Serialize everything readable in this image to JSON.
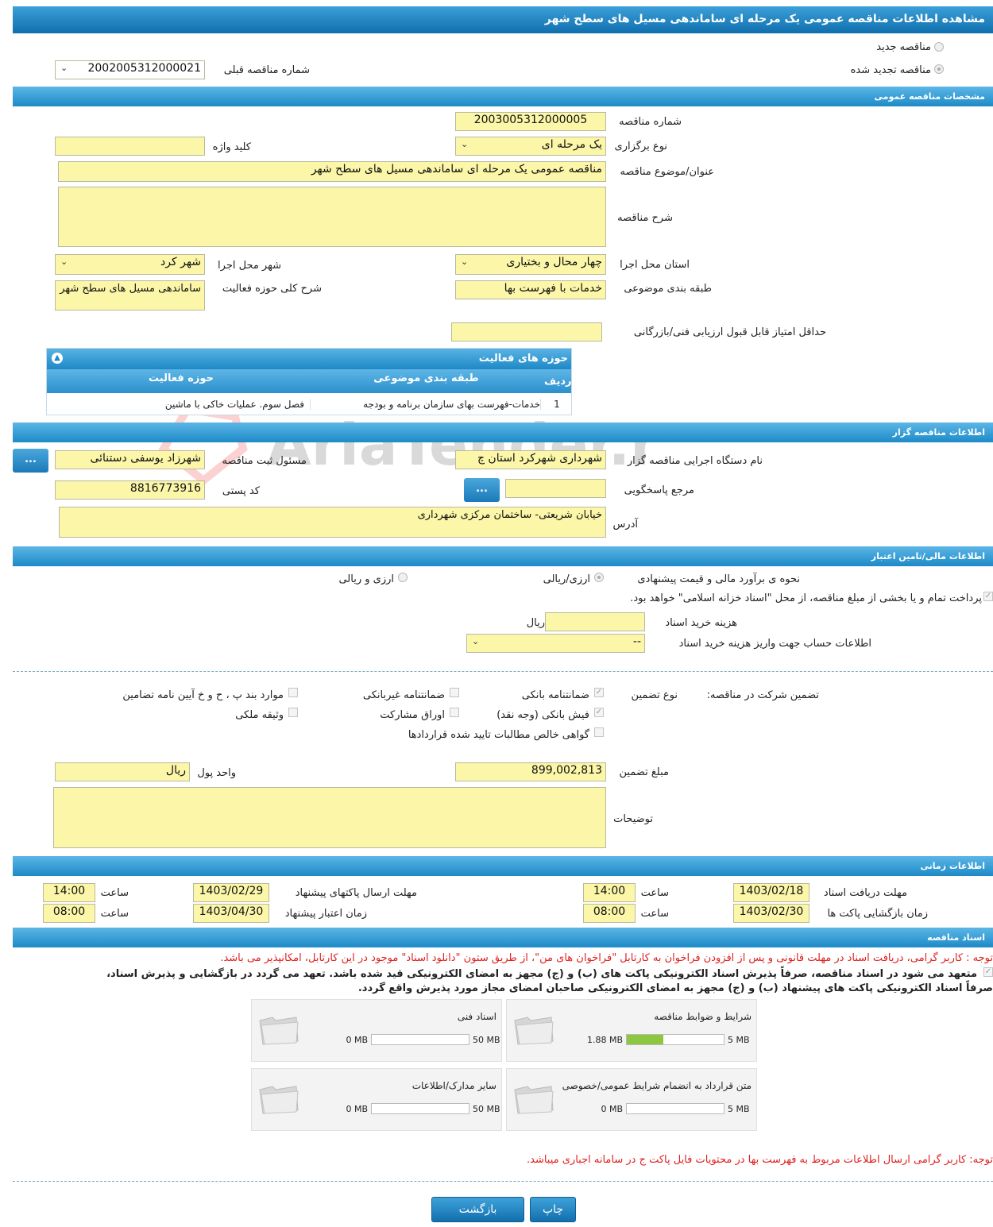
{
  "page": {
    "title": "مشاهده اطلاعات مناقصه عمومی یک مرحله ای ساماندهی مسیل های سطح شهر",
    "radio_new": "مناقصه جدید",
    "radio_renewed": "مناقصه تجدید شده",
    "prev_number_label": "شماره مناقصه قبلی",
    "prev_number_value": "2002005312000021"
  },
  "general": {
    "header": "مشخصات مناقصه عمومی",
    "number_label": "شماره مناقصه",
    "number_value": "2003005312000005",
    "type_label": "نوع برگزاری",
    "type_value": "یک مرحله ای",
    "keyword_label": "کلید واژه",
    "keyword_value": "",
    "subject_label": "عنوان/موضوع مناقصه",
    "subject_value": "مناقصه عمومی یک مرحله ای  ساماندهی مسیل های سطح شهر",
    "description_label": "شرح مناقصه",
    "description_value": "",
    "province_label": "استان محل اجرا",
    "province_value": "چهار محال و بختیاری",
    "city_label": "شهر محل اجرا",
    "city_value": "شهر کرد",
    "category_label": "طبقه بندی موضوعی",
    "category_value": "خدمات با فهرست بها",
    "activity_label": "شرح کلی حوزه فعالیت",
    "activity_value": "ساماندهی مسیل های سطح شهر",
    "min_score_label": "حداقل امتیاز قابل قبول ارزیابی فنی/بازرگانی",
    "min_score_value": ""
  },
  "activity_table": {
    "title": "حوزه های فعالیت",
    "columns": [
      "ردیف",
      "طبقه بندی موضوعی",
      "حوزه فعالیت"
    ],
    "rows": [
      [
        "1",
        "خدمات-فهرست بهای سازمان برنامه و بودجه",
        "فصل سوم. عملیات خاکی با ماشین"
      ]
    ]
  },
  "organizer": {
    "header": "اطلاعات مناقصه گزار",
    "org_label": "نام دستگاه اجرایی مناقصه گزار",
    "org_value": "شهرداری شهرکرد استان چ",
    "responsible_label": "مسئول ثبت مناقصه",
    "responsible_value": "شهرزاد یوسفی دستنائی",
    "reference_label": "مرجع پاسخگویی",
    "reference_value": "",
    "postal_label": "کد پستی",
    "postal_value": "8816773916",
    "address_label": "آدرس",
    "address_value": "خیابان شریعتی- ساختمان مرکزی شهرداری",
    "dots": "..."
  },
  "financial": {
    "header": "اطلاعات مالی/تامین اعتبار",
    "estimate_label": "نحوه ی برآورد مالی و قیمت پیشنهادی",
    "opt_currency_rial": "ارزی/ریالی",
    "opt_currency_and_rial": "ارزی و ریالی",
    "treasury_note": "پرداخت تمام و یا بخشی از مبلغ مناقصه، از محل \"اسناد خزانه اسلامی\" خواهد بود.",
    "doc_cost_label": "هزینه خرید اسناد",
    "doc_cost_value": "",
    "rial": "ریال",
    "account_label": "اطلاعات حساب جهت واریز هزینه خرید اسناد",
    "account_value": "--"
  },
  "guarantee": {
    "participation_label": "تضمین شرکت در مناقصه:",
    "type_label": "نوع تضمین",
    "bank_guarantee": "ضمانتنامه بانکی",
    "non_bank_guarantee": "ضمانتنامه غیربانکی",
    "bylaw_items": "موارد بند پ ، ح و خ آیین نامه تضامین",
    "bank_receipt": "فیش بانکی (وجه نقد)",
    "participation_bonds": "اوراق مشارکت",
    "property_collateral": "وثیقه ملکی",
    "net_claims": "گواهی خالص مطالبات تایید شده قراردادها",
    "amount_label": "مبلغ تضمین",
    "amount_value": "899,002,813",
    "currency_label": "واحد پول",
    "currency_value": "ریال",
    "notes_label": "توضیحات",
    "notes_value": ""
  },
  "timing": {
    "header": "اطلاعات زمانی",
    "doc_receive_label": "مهلت دریافت اسناد",
    "doc_receive_date": "1403/02/18",
    "doc_receive_time": "14:00",
    "send_deadline_label": "مهلت ارسال پاکتهای پیشنهاد",
    "send_deadline_date": "1403/02/29",
    "send_deadline_time": "14:00",
    "opening_label": "زمان بازگشایی پاکت ها",
    "opening_date": "1403/02/30",
    "opening_time": "08:00",
    "validity_label": "زمان اعتبار پیشنهاد",
    "validity_date": "1403/04/30",
    "validity_time": "08:00",
    "time_label": "ساعت"
  },
  "documents": {
    "header": "اسناد مناقصه",
    "note_red": "توجه : کاربر گرامی، دریافت اسناد در مهلت قانونی و پس از افزودن فراخوان به کارتابل \"فراخوان های من\"، از طریق ستون \"دانلود اسناد\" موجود در این کارتابل، امکانپذیر می باشد.",
    "commit_line1": "متعهد می شود در اسناد مناقصه، صرفاً پذیرش اسناد الکترونیکی پاکت های (ب) و (ج) مجهز به امضای الکترونیکی قید شده باشد. تعهد می گردد در بازگشایی و پذیرش اسناد،",
    "commit_line2": "صرفاً اسناد الکترونیکی پاکت های پیشنهاد (ب) و (ج) مجهز به امضای الکترونیکی صاحبان امضای مجاز مورد پذیرش واقع گردد.",
    "tiles": [
      {
        "name": "شرایط و ضوابط مناقصه",
        "used": "1.88 MB",
        "max": "5 MB",
        "fill": 0.376
      },
      {
        "name": "اسناد فنی",
        "used": "0 MB",
        "max": "50 MB",
        "fill": 0
      },
      {
        "name": "متن قرارداد به انضمام شرایط عمومی/خصوصی",
        "used": "0 MB",
        "max": "5 MB",
        "fill": 0
      },
      {
        "name": "سایر مدارک/اطلاعات",
        "used": "0 MB",
        "max": "50 MB",
        "fill": 0
      }
    ],
    "note_bottom": "توجه: کاربر گرامی ارسال اطلاعات مربوط به فهرست بها در محتویات فایل پاکت ج در سامانه اجباری میباشد."
  },
  "actions": {
    "back": "بازگشت",
    "print": "چاپ"
  },
  "watermark": "AriaTender.neT"
}
